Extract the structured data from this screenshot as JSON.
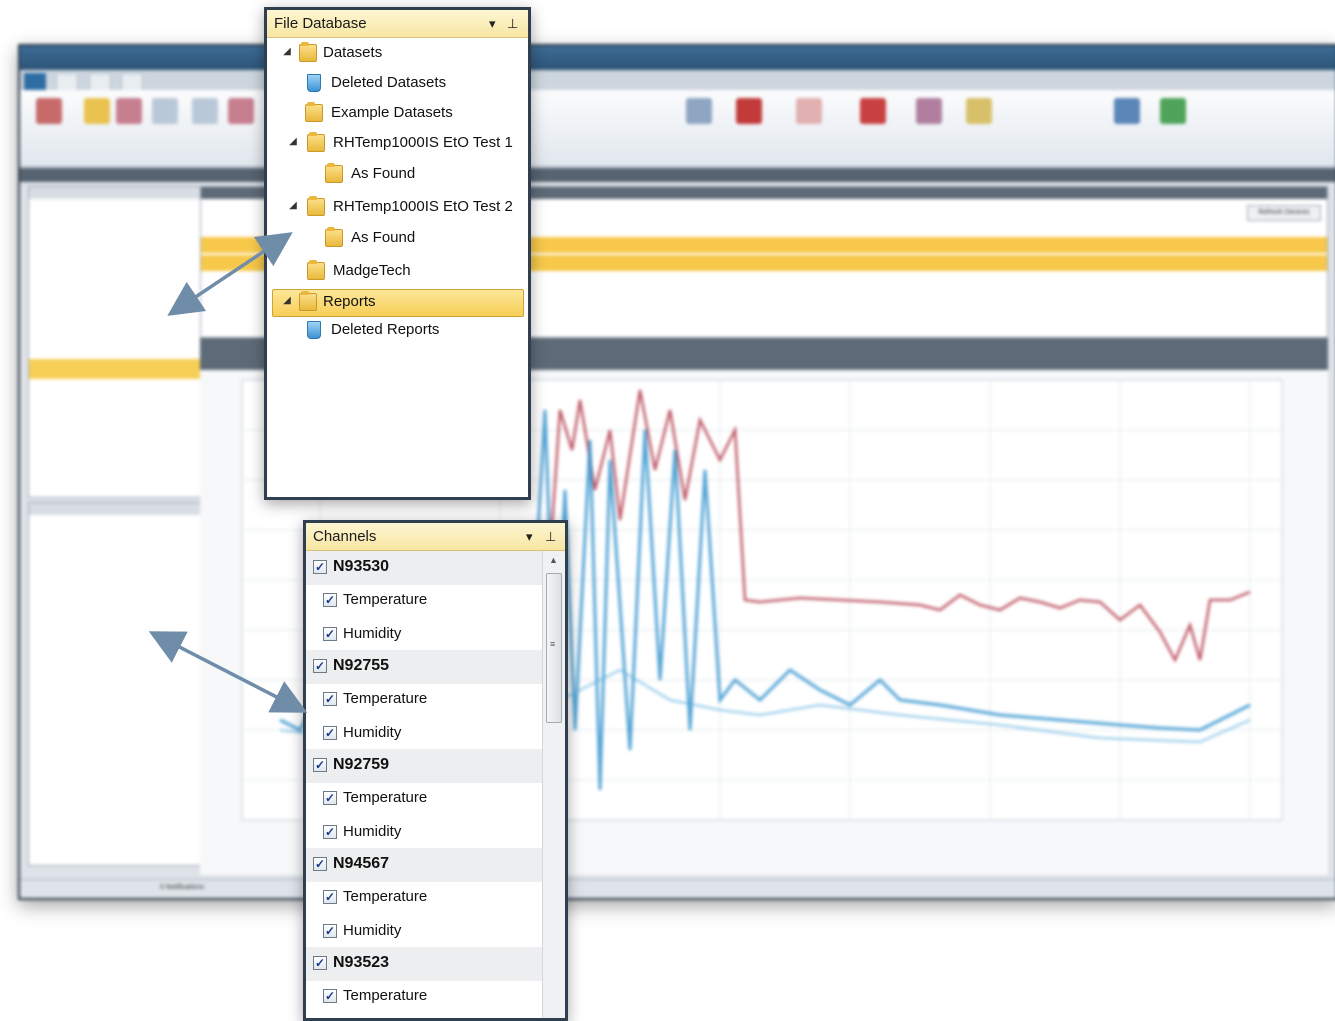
{
  "file_database": {
    "title": "File Database",
    "items": [
      {
        "label": "Datasets",
        "expanded": true,
        "icon": "datasets-folder-icon"
      },
      {
        "label": "Deleted Datasets",
        "icon": "recycle-bin-icon"
      },
      {
        "label": "Example Datasets",
        "icon": "folder-icon"
      },
      {
        "label": "RHTemp1000IS EtO Test 1",
        "expanded": true,
        "icon": "folder-icon"
      },
      {
        "label": "As Found",
        "icon": "folder-icon"
      },
      {
        "label": "RHTemp1000IS EtO Test 2",
        "expanded": true,
        "icon": "folder-icon"
      },
      {
        "label": "As Found",
        "icon": "folder-icon"
      },
      {
        "label": "MadgeTech",
        "icon": "folder-icon"
      },
      {
        "label": "Reports",
        "expanded": true,
        "selected": true,
        "icon": "reports-folder-icon"
      },
      {
        "label": "Deleted Reports",
        "icon": "recycle-bin-icon"
      }
    ]
  },
  "channels": {
    "title": "Channels",
    "groups": [
      {
        "device": "N93530",
        "channels": [
          "Temperature",
          "Humidity"
        ]
      },
      {
        "device": "N92755",
        "channels": [
          "Temperature",
          "Humidity"
        ]
      },
      {
        "device": "N92759",
        "channels": [
          "Temperature",
          "Humidity"
        ]
      },
      {
        "device": "N94567",
        "channels": [
          "Temperature",
          "Humidity"
        ]
      },
      {
        "device": "N93523",
        "channels": [
          "Temperature"
        ]
      }
    ]
  },
  "background_app": {
    "status_notifications": "0 Notifications",
    "refresh_button": "Refresh Devices"
  },
  "colors": {
    "selection": "#f7ce56",
    "panel_header": "#f7e6a2",
    "temperature_series": "#b5404f",
    "humidity_series": "#2b8ecc",
    "callout_arrow": "#6f8ca8"
  }
}
